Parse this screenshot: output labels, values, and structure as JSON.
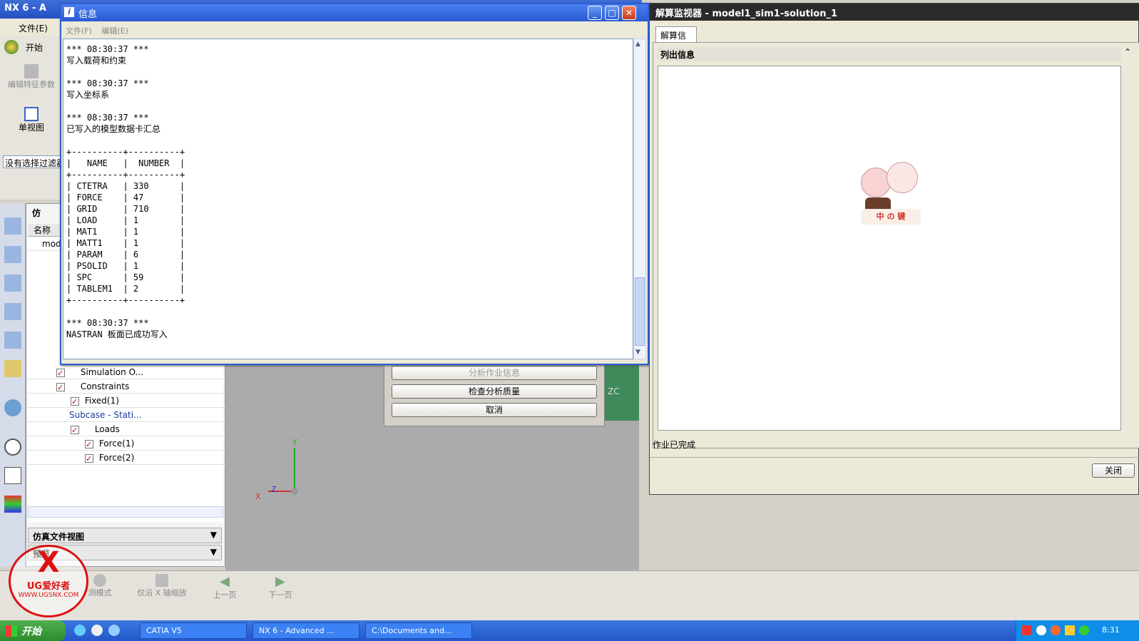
{
  "nx_window": {
    "title": "NX 6 - A",
    "menu": {
      "file": "文件(E)",
      "start": "开始"
    },
    "toolbar": {
      "edit_feature": "编辑特征参数",
      "single_view": "单视图",
      "filter": "没有选择过滤器"
    },
    "navigator": {
      "header_col_name": "名称",
      "tab_label": "仿",
      "rows": [
        {
          "label": "mod"
        },
        {
          "label": "Simulation O..."
        },
        {
          "label": "Constraints"
        },
        {
          "label": "Fixed(1)"
        },
        {
          "label": "Subcase - Stati..."
        },
        {
          "label": "Loads"
        },
        {
          "label": "Force(1)"
        },
        {
          "label": "Force(2)"
        }
      ],
      "panel_sim_file_view": "仿真文件视图",
      "panel_preview": "预览"
    },
    "analysis_buttons": {
      "job_info": "分析作业信息",
      "check_quality": "检查分析质量",
      "cancel": "取消"
    },
    "axes": {
      "x": "X",
      "y": "Y",
      "z": "Z",
      "zc": "ZC"
    },
    "bottom_toolbar": {
      "measure_mode": "测模式",
      "along_x": "仅沿 X 轴缩放",
      "prev_page": "上一页",
      "next_page": "下一页"
    }
  },
  "info_dialog": {
    "title": "信息",
    "menu": {
      "file": "文件(F)",
      "edit": "编辑(E)"
    },
    "log": [
      "*** 08:30:37 ***",
      "写入载荷和约束",
      "",
      "*** 08:30:37 ***",
      "写入坐标系",
      "",
      "*** 08:30:37 ***",
      "已写入的模型数据卡汇总",
      "",
      "+----------+----------+",
      "|   NAME   |  NUMBER  |",
      "+----------+----------+",
      "| CTETRA   | 330      |",
      "| FORCE    | 47       |",
      "| GRID     | 710      |",
      "| LOAD     | 1        |",
      "| MAT1     | 1        |",
      "| MATT1    | 1        |",
      "| PARAM    | 6        |",
      "| PSOLID   | 1        |",
      "| SPC      | 59       |",
      "| TABLEM1  | 2        |",
      "+----------+----------+",
      "",
      "*** 08:30:37 ***",
      "NASTRAN 板面已成功写入"
    ]
  },
  "solve_monitor": {
    "title": "解算监视器 - model1_sim1-solution_1",
    "tab": "解算信息",
    "section": "列出信息",
    "status": "作业已完成",
    "close_button": "关闭",
    "sticker_text": "中 の 键"
  },
  "watermark": {
    "brand": "UG爱好者",
    "url": "WWW.UGSNX.COM"
  },
  "taskbar": {
    "start": "开始",
    "items": [
      "CATIA V5",
      "NX 6 - Advanced ...",
      "C:\\Documents and..."
    ],
    "clock": "8:31"
  },
  "colors": {
    "title_blue": "#2a5ad2",
    "check_red": "#cc0000",
    "taskbar_blue": "#2257c8"
  }
}
